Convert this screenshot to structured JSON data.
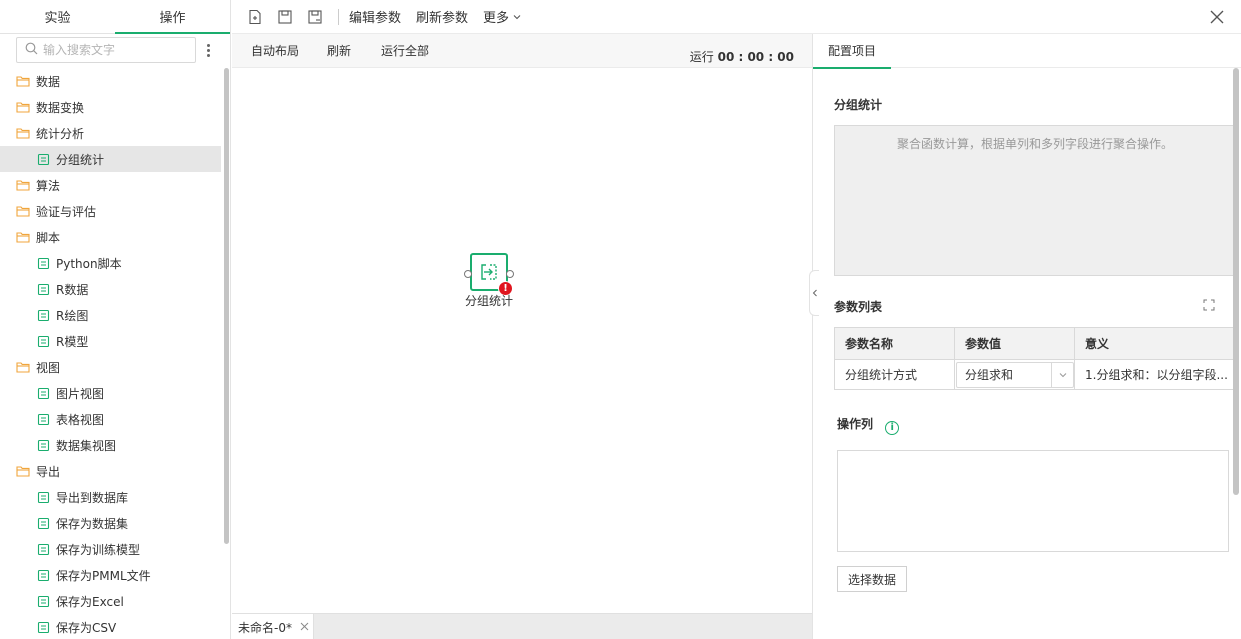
{
  "left_panel": {
    "tabs": [
      {
        "label": "实验"
      },
      {
        "label": "操作"
      }
    ],
    "search": {
      "placeholder": "输入搜索文字"
    },
    "tree": [
      {
        "label": "数据",
        "type": "folder"
      },
      {
        "label": "数据变换",
        "type": "folder"
      },
      {
        "label": "统计分析",
        "type": "folder"
      },
      {
        "label": "分组统计",
        "type": "leaf"
      },
      {
        "label": "算法",
        "type": "folder"
      },
      {
        "label": "验证与评估",
        "type": "folder"
      },
      {
        "label": "脚本",
        "type": "folder"
      },
      {
        "label": "Python脚本",
        "type": "leaf"
      },
      {
        "label": "R数据",
        "type": "leaf"
      },
      {
        "label": "R绘图",
        "type": "leaf"
      },
      {
        "label": "R模型",
        "type": "leaf"
      },
      {
        "label": "视图",
        "type": "folder"
      },
      {
        "label": "图片视图",
        "type": "leaf"
      },
      {
        "label": "表格视图",
        "type": "leaf"
      },
      {
        "label": "数据集视图",
        "type": "leaf"
      },
      {
        "label": "导出",
        "type": "folder"
      },
      {
        "label": "导出到数据库",
        "type": "leaf"
      },
      {
        "label": "保存为数据集",
        "type": "leaf"
      },
      {
        "label": "保存为训练模型",
        "type": "leaf"
      },
      {
        "label": "保存为PMML文件",
        "type": "leaf"
      },
      {
        "label": "保存为Excel",
        "type": "leaf"
      },
      {
        "label": "保存为CSV",
        "type": "leaf"
      }
    ]
  },
  "toolbar": {
    "edit_params": "编辑参数",
    "refresh_params": "刷新参数",
    "more": "更多"
  },
  "canvas": {
    "auto_layout": "自动布局",
    "refresh": "刷新",
    "run_all": "运行全部",
    "runtime_label": "运行",
    "runtime_value": "00 : 00 : 00",
    "node_label": "分组统计",
    "node_error_mark": "!"
  },
  "bottom": {
    "doc_tab": "未命名-0*"
  },
  "right_panel": {
    "tab": "配置项目",
    "component_title": "分组统计",
    "description": "聚合函数计算，根据单列和多列字段进行聚合操作。",
    "params_title": "参数列表",
    "table_headers": [
      "参数名称",
      "参数值",
      "意义"
    ],
    "rows": [
      {
        "name": "分组统计方式",
        "value": "分组求和",
        "meaning": "1.分组求和：以分组字段..."
      }
    ],
    "ops_title": "操作列",
    "info_mark": "i",
    "select_data_button": "选择数据"
  },
  "colors": {
    "accent": "#1aad6e",
    "error": "#e0161f",
    "folder": "#f0a53c"
  }
}
